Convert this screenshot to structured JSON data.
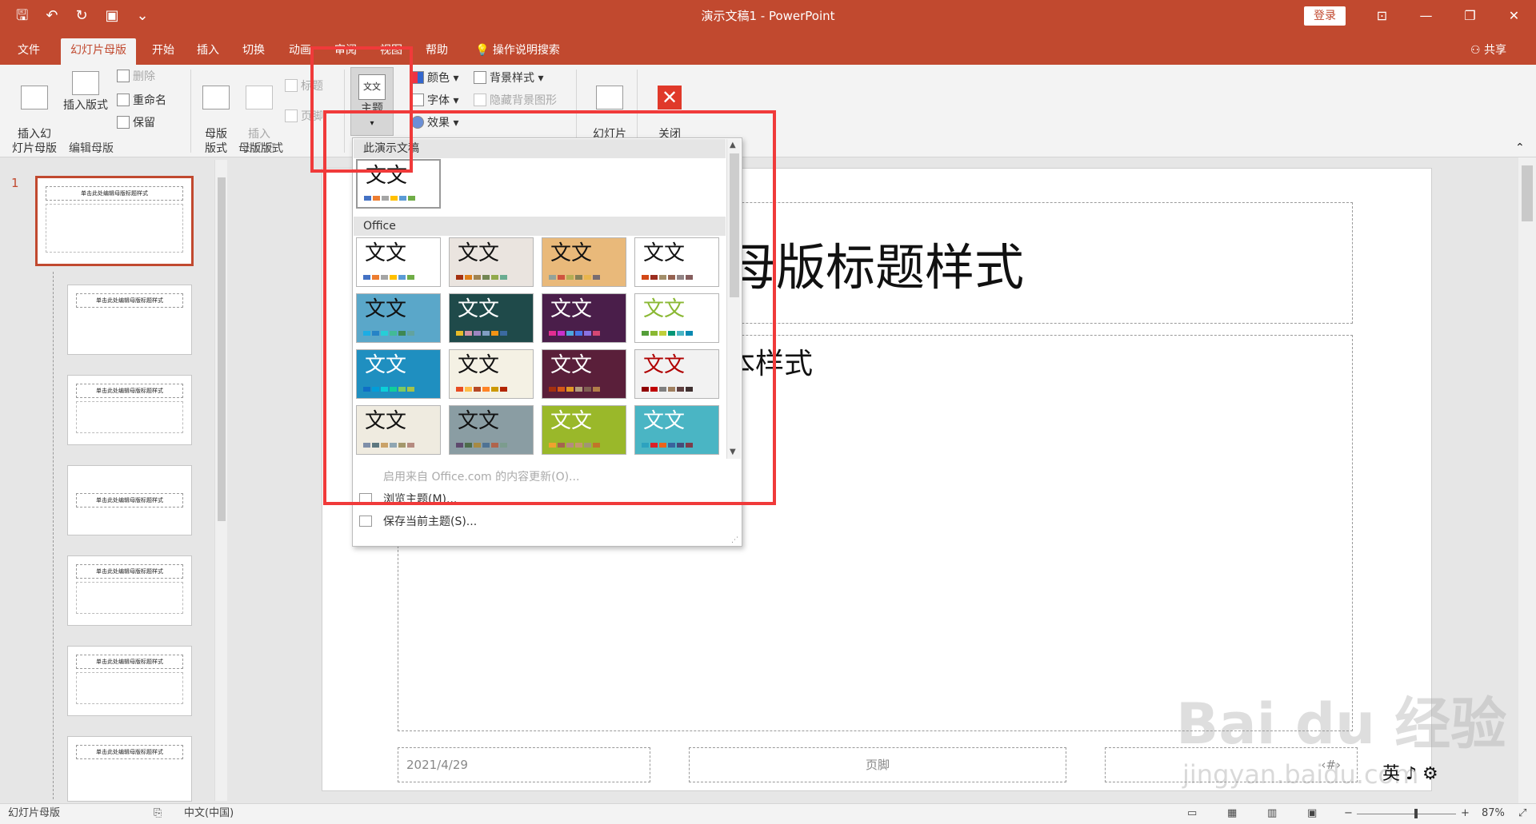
{
  "titlebar": {
    "doc_title": "演示文稿1  -  PowerPoint",
    "login": "登录",
    "qat_icons": [
      "save-icon",
      "undo-icon",
      "redo-icon",
      "present-icon",
      "customize-icon"
    ]
  },
  "tabs": [
    {
      "label": "文件"
    },
    {
      "label": "幻灯片母版"
    },
    {
      "label": "开始"
    },
    {
      "label": "插入"
    },
    {
      "label": "切换"
    },
    {
      "label": "动画"
    },
    {
      "label": "审阅"
    },
    {
      "label": "视图"
    },
    {
      "label": "帮助"
    },
    {
      "label": "操作说明搜索"
    }
  ],
  "share": "共享",
  "ribbon": {
    "insert_slide_master": "插入幻\n灯片母版",
    "insert_layout": "插入版式",
    "delete": "删除",
    "rename": "重命名",
    "preserve": "保留",
    "edit_master_group": "编辑母版",
    "master_layout": "母版\n版式",
    "insert_placeholder": "插入\n占位符",
    "title_cb": "标题",
    "footer_cb": "页脚",
    "master_layout_group": "母版版式",
    "theme": "主题",
    "colors": "颜色",
    "fonts": "字体",
    "effects": "效果",
    "background_styles": "背景样式",
    "hide_bg": "隐藏背景图形",
    "slide_size": "幻灯片\n大小",
    "close": "关闭\n母版视图"
  },
  "slides": [
    {
      "num": "1",
      "title": "单击此处编辑母版标题样式"
    },
    {
      "title": "单击此处编辑母版标题样式"
    },
    {
      "title": "单击此处编辑母版标题样式"
    },
    {
      "title": "单击此处编辑母版标题样式"
    },
    {
      "title": "单击此处编辑母版标题样式"
    },
    {
      "title": "单击此处编辑母版标题样式"
    },
    {
      "title": "单击此处编辑母版标题样式"
    }
  ],
  "slide": {
    "title_text": "母版标题样式",
    "body_text": "本样式",
    "date": "2021/4/29",
    "footer": "页脚",
    "number": "‹#›"
  },
  "ime": "英 ♪ ⚙",
  "dropdown": {
    "section_current": "此演示文稿",
    "section_office": "Office",
    "sample": "文文",
    "themes": [
      {
        "bg": "#ffffff",
        "fg": "#111111",
        "colors": [
          "#4472c4",
          "#ed7d31",
          "#a5a5a5",
          "#ffc000",
          "#5b9bd5",
          "#70ad47"
        ]
      },
      {
        "bg": "#ffffff",
        "fg": "#111111",
        "colors": [
          "#4472c4",
          "#ed7d31",
          "#a5a5a5",
          "#ffc000",
          "#5b9bd5",
          "#70ad47"
        ]
      },
      {
        "bg": "#eae4df",
        "fg": "#111111",
        "colors": [
          "#a53010",
          "#de7e18",
          "#9f8351",
          "#728653",
          "#92aa4c",
          "#6aac91"
        ]
      },
      {
        "bg": "#e9b97a",
        "fg": "#111111",
        "colors": [
          "#93a299",
          "#cf543f",
          "#b5ae53",
          "#848058",
          "#e8b54d",
          "#786c71"
        ]
      },
      {
        "bg": "#ffffff",
        "fg": "#111111",
        "colors": [
          "#d34817",
          "#9b2d1f",
          "#a28e6a",
          "#956251",
          "#918485",
          "#855d5d"
        ]
      },
      {
        "bg": "#5aa7c9",
        "fg": "#111111",
        "colors": [
          "#1cade4",
          "#2683c6",
          "#27ced7",
          "#42ba97",
          "#3e8853",
          "#62a39f"
        ]
      },
      {
        "bg": "#1f4a4a",
        "fg": "#ffffff",
        "colors": [
          "#e7bc29",
          "#d092a7",
          "#9c85c0",
          "#809ec2",
          "#f09415",
          "#3b6aa0"
        ]
      },
      {
        "bg": "#4a1e4a",
        "fg": "#ffffff",
        "colors": [
          "#e32d91",
          "#c830cc",
          "#4ea6dc",
          "#4775e7",
          "#8971e1",
          "#d54773"
        ]
      },
      {
        "bg": "#ffffff",
        "fg": "#8ab833",
        "colors": [
          "#549e39",
          "#8ab833",
          "#c0cf3a",
          "#029676",
          "#4ab5c4",
          "#0989b1"
        ]
      },
      {
        "bg": "#1f8fc0",
        "fg": "#ffffff",
        "colors": [
          "#0f6fc6",
          "#009dd9",
          "#0bd0d9",
          "#10cf9b",
          "#7cca62",
          "#a5c249"
        ]
      },
      {
        "bg": "#f4f1e4",
        "fg": "#111111",
        "colors": [
          "#e84c22",
          "#ffbd47",
          "#b64926",
          "#ff8427",
          "#cc9900",
          "#b22600"
        ]
      },
      {
        "bg": "#5a1f3a",
        "fg": "#ffffff",
        "colors": [
          "#a5300f",
          "#d55816",
          "#e19825",
          "#b19c7d",
          "#7f5f52",
          "#b27d49"
        ]
      },
      {
        "bg": "#f2f2f2",
        "fg": "#b00000",
        "colors": [
          "#900000",
          "#c00000",
          "#808080",
          "#a08060",
          "#604040",
          "#403030"
        ]
      },
      {
        "bg": "#efebe0",
        "fg": "#111111",
        "colors": [
          "#7f8fa9",
          "#5e7880",
          "#caa268",
          "#8fa6b2",
          "#a4986c",
          "#b58b80"
        ]
      },
      {
        "bg": "#8a9da3",
        "fg": "#111111",
        "colors": [
          "#5e4a6e",
          "#4d6c4a",
          "#a78a43",
          "#4e7294",
          "#b0644c",
          "#7c9c8e"
        ]
      },
      {
        "bg": "#9ab82a",
        "fg": "#ffffff",
        "colors": [
          "#f0a22e",
          "#a5644e",
          "#b58b80",
          "#c3986d",
          "#a19574",
          "#c17529"
        ]
      },
      {
        "bg": "#4ab5c4",
        "fg": "#ffffff",
        "colors": [
          "#2da2bf",
          "#da1f28",
          "#eb641b",
          "#39639d",
          "#474b78",
          "#7d3c4a"
        ]
      }
    ],
    "office_update": "启用来自 Office.com 的内容更新(O)...",
    "browse_themes": "浏览主题(M)...",
    "save_theme": "保存当前主题(S)..."
  },
  "statusbar": {
    "mode": "幻灯片母版",
    "language": "中文(中国)",
    "zoom": "87%",
    "zoom_level": 0.6
  },
  "watermark": "Bai du 经验",
  "watermark_sub": "jingyan.baidu.com"
}
